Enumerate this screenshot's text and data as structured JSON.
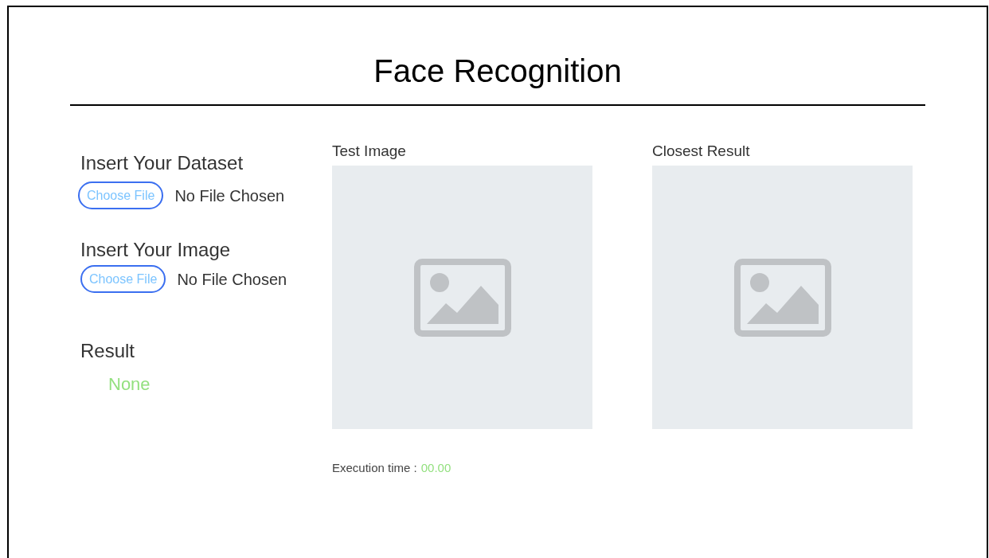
{
  "title": "Face Recognition",
  "uploads": [
    {
      "label": "Insert Your Dataset",
      "button": "Choose File",
      "status": "No File Chosen"
    },
    {
      "label": "Insert Your Image",
      "button": "Choose File",
      "status": "No File Chosen"
    }
  ],
  "result": {
    "label": "Result",
    "value": "None"
  },
  "panels": [
    {
      "label": "Test Image"
    },
    {
      "label": "Closest Result"
    }
  ],
  "execution": {
    "label": "Execution time :",
    "value": "00.00"
  }
}
